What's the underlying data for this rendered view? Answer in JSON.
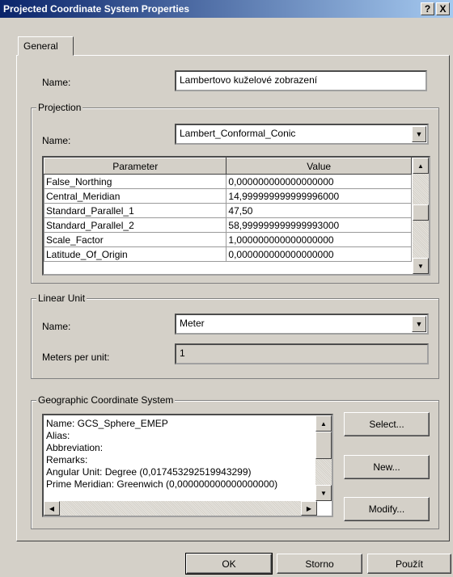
{
  "window": {
    "title": "Projected Coordinate System Properties",
    "help_label": "?",
    "close_label": "X"
  },
  "tabs": [
    {
      "label": "General",
      "active": true
    }
  ],
  "name_section": {
    "label": "Name:",
    "value": "Lambertovo kuželové zobrazení"
  },
  "projection": {
    "group_title": "Projection",
    "name_label": "Name:",
    "name_value": "Lambert_Conformal_Conic",
    "columns": [
      "Parameter",
      "Value"
    ],
    "rows": [
      {
        "parameter": "False_Northing",
        "value": "0,000000000000000000"
      },
      {
        "parameter": "Central_Meridian",
        "value": "14,999999999999996000"
      },
      {
        "parameter": "Standard_Parallel_1",
        "value": "47,50"
      },
      {
        "parameter": "Standard_Parallel_2",
        "value": "58,999999999999993000"
      },
      {
        "parameter": "Scale_Factor",
        "value": "1,000000000000000000"
      },
      {
        "parameter": "Latitude_Of_Origin",
        "value": "0,000000000000000000"
      }
    ]
  },
  "linear_unit": {
    "group_title": "Linear Unit",
    "name_label": "Name:",
    "name_value": "Meter",
    "meters_label": "Meters per unit:",
    "meters_value": "1"
  },
  "gcs": {
    "group_title": "Geographic Coordinate System",
    "lines": [
      "Name: GCS_Sphere_EMEP",
      "Alias:",
      "Abbreviation:",
      "Remarks:",
      "Angular Unit: Degree (0,017453292519943299)",
      "Prime Meridian: Greenwich (0,000000000000000000)"
    ],
    "select_label": "Select...",
    "new_label": "New...",
    "modify_label": "Modify..."
  },
  "footer": {
    "ok_label": "OK",
    "cancel_label": "Storno",
    "apply_label": "Použít"
  },
  "icons": {
    "dropdown": "chevron-down-icon",
    "scroll_up": "arrow-up-icon",
    "scroll_down": "arrow-down-icon",
    "scroll_left": "arrow-left-icon",
    "scroll_right": "arrow-right-icon"
  },
  "colors": {
    "titlebar_start": "#0a246a",
    "titlebar_end": "#a6caf0",
    "face": "#d4d0c8"
  }
}
